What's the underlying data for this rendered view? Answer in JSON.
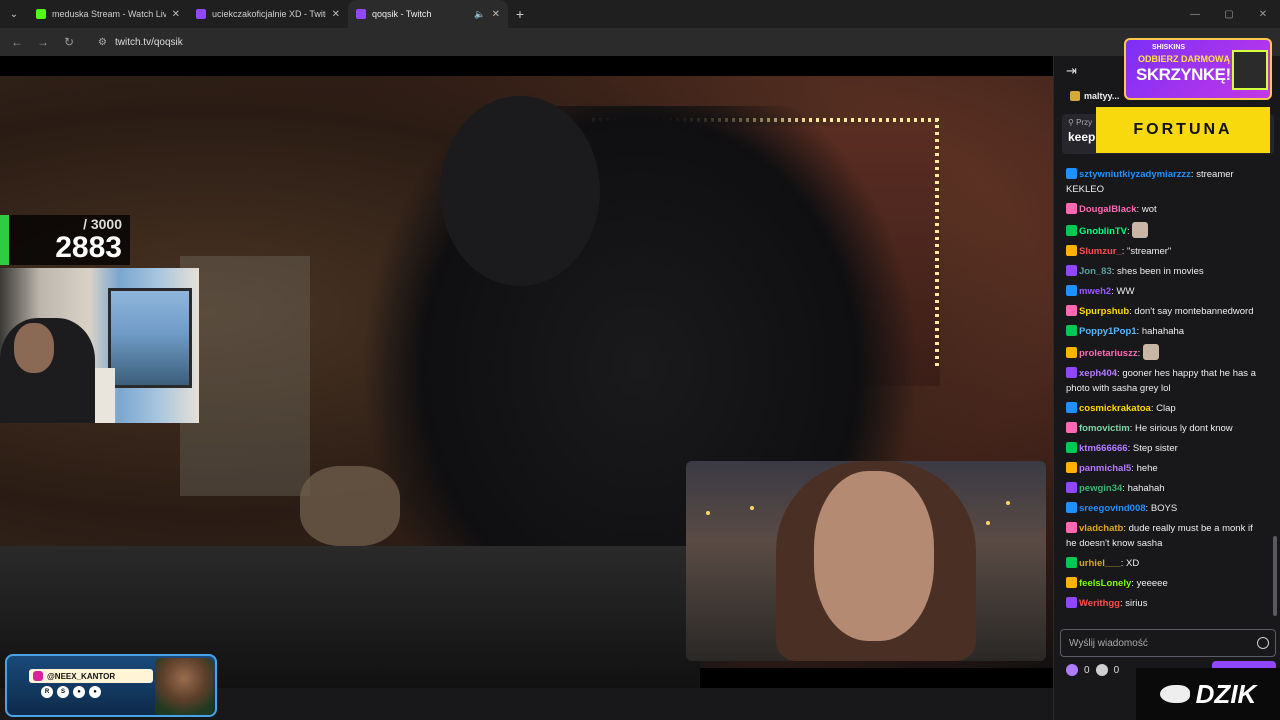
{
  "browser": {
    "tabs": [
      {
        "label": "meduska Stream - Watch Live o",
        "color": "#53fc18"
      },
      {
        "label": "uciekczakoficjalnie XD - Twitch",
        "color": "#9147ff"
      },
      {
        "label": "qoqsik - Twitch",
        "color": "#9147ff"
      }
    ],
    "url": "twitch.tv/qoqsik"
  },
  "overlay": {
    "counter_max": "/ 3000",
    "counter_value": "2883",
    "counter_fill_fraction": 0.961,
    "sponsor_handle": "@NEEX_KANTOR"
  },
  "chat": {
    "gift_user": "maltyy...",
    "pinned_label": "Przy",
    "pinned_text": "keep",
    "messages": [
      {
        "user": "sztywniutkiyzadymiarzzz",
        "color": "#1e90ff",
        "text": "streamer KEKLEO"
      },
      {
        "user": "DougalBlack",
        "color": "#ff69b4",
        "text": "wot"
      },
      {
        "user": "GnoblinTV",
        "color": "#00ff7f",
        "text": ""
      },
      {
        "user": "Slumzur_",
        "color": "#ff4d4d",
        "text": "\"streamer\""
      },
      {
        "user": "Jon_83",
        "color": "#5f9ea0",
        "text": "shes been in movies"
      },
      {
        "user": "mweh2",
        "color": "#9b59ff",
        "text": "WW"
      },
      {
        "user": "Spurpshub",
        "color": "#ffd700",
        "text": "don't say montebannedword"
      },
      {
        "user": "Poppy1Pop1",
        "color": "#57b9ff",
        "text": "hahahaha"
      },
      {
        "user": "proletariuszz",
        "color": "#ff69b4",
        "text": ""
      },
      {
        "user": "xeph404",
        "color": "#b77bff",
        "text": "gooner hes happy that he has a photo with sasha grey lol"
      },
      {
        "user": "cosmickrakatoa",
        "color": "#ffd700",
        "text": "Clap"
      },
      {
        "user": "fomovictim",
        "color": "#7fd7a6",
        "text": "He sirious ly dont know"
      },
      {
        "user": "ktm666666",
        "color": "#b77bff",
        "text": "Step sister"
      },
      {
        "user": "panmichal5",
        "color": "#b77bff",
        "text": "hehe"
      },
      {
        "user": "pewgin34",
        "color": "#3cb371",
        "text": "hahahah"
      },
      {
        "user": "sreegovind008",
        "color": "#1e90ff",
        "text": "BOYS"
      },
      {
        "user": "vladchatb",
        "color": "#daa520",
        "text": "dude really must be a monk if he doesn't know sasha"
      },
      {
        "user": "urhiel___",
        "color": "#daa520",
        "text": "XD"
      },
      {
        "user": "feelsLonely",
        "color": "#7cfc00",
        "text": "yeeeee"
      },
      {
        "user": "Werithgg",
        "color": "#ff4d4d",
        "text": "sirius"
      }
    ],
    "input_placeholder": "Wyślij wiadomość",
    "points_a": "0",
    "points_b": "0"
  },
  "ads": {
    "skins_brand": "SHISKINS",
    "skins_line1": "ODBIERZ DARMOWĄ",
    "skins_line2": "SKRZYNKĘ!",
    "fortuna": "FORTUNA",
    "dzik": "DZIK"
  },
  "icons": {
    "tab_menu": "chevron-down-icon",
    "back": "arrow-left-icon",
    "forward": "arrow-right-icon",
    "reload": "reload-icon",
    "collapse": "collapse-chat-icon",
    "emoji": "emoji-icon"
  }
}
